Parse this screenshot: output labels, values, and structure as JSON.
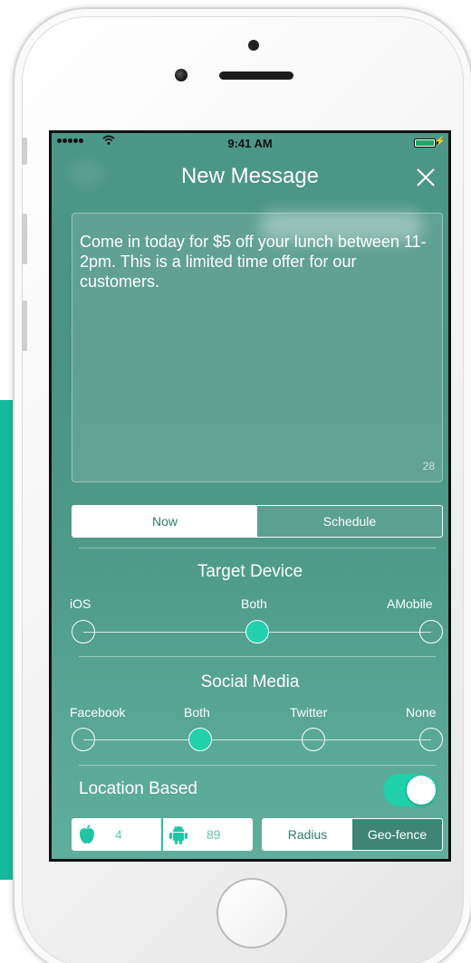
{
  "status_bar": {
    "time": "9:41 AM"
  },
  "nav": {
    "title": "New Message"
  },
  "message": {
    "text": "Come in today for $5 off your lunch between 11-2pm. This is a limited time offer for our customers.",
    "char_count": "28"
  },
  "send_time": {
    "options": [
      "Now",
      "Schedule"
    ],
    "selected": "Now"
  },
  "target_device": {
    "title": "Target Device",
    "options": [
      "iOS",
      "Both",
      "AMobile"
    ],
    "selected": "Both"
  },
  "social_media": {
    "title": "Social Media",
    "options": [
      "Facebook",
      "Both",
      "Twitter",
      "None"
    ],
    "selected": "Both"
  },
  "location": {
    "label": "Location Based",
    "enabled": true
  },
  "counts": {
    "apple": "4",
    "android": "89"
  },
  "area_mode": {
    "options": [
      "Radius",
      "Geo-fence"
    ],
    "selected": "Geo-fence"
  },
  "icons": {
    "close": "close-icon",
    "apple": "apple-icon",
    "android": "android-icon",
    "wifi": "wifi-icon",
    "battery": "battery-icon"
  },
  "colors": {
    "accent": "#22d1ac",
    "screen_bg": "#4c9787",
    "strip": "#17b99d"
  }
}
